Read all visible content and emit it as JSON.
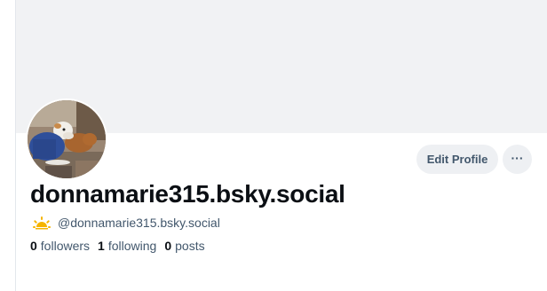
{
  "profile": {
    "display_name": "donnamarie315.bsky.social",
    "handle": "@donnamarie315.bsky.social",
    "status_icon": "sunrise-icon",
    "avatar_icon": "dog-photo",
    "stats": {
      "followers_count": "0",
      "followers_label": "followers",
      "following_count": "1",
      "following_label": "following",
      "posts_count": "0",
      "posts_label": "posts"
    }
  },
  "actions": {
    "edit_profile_label": "Edit Profile",
    "more_label": "···"
  },
  "colors": {
    "banner": "#f1f2f4",
    "button_bg": "#eef0f3",
    "muted_text": "#42576c",
    "primary_text": "#0b0f14",
    "sun": "#f5b400"
  }
}
